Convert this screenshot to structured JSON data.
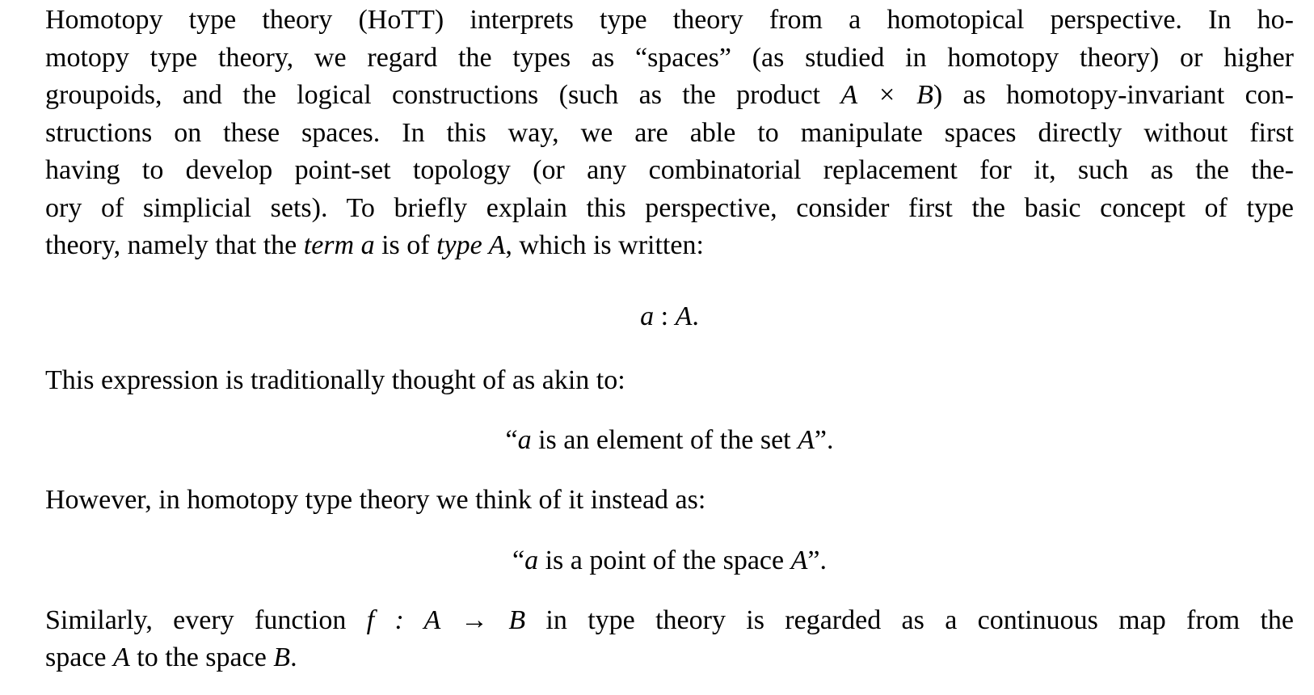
{
  "paragraph_intro": {
    "lines": [
      "Homotopy type theory (HoTT) interprets type theory from a homotopical perspective.  In ho-",
      "motopy type theory, we regard the types as “spaces” (as studied in homotopy theory) or higher",
      "groupoids, and the logical constructions (such as the product ",
      "structions on these spaces.  In this way, we are able to manipulate spaces directly without first",
      "having to develop point-set topology (or any combinatorial replacement for it, such as the the-",
      "ory of simplicial sets). To briefly explain this perspective, consider first the basic concept of type",
      "theory, namely that the "
    ],
    "product_expr": "A × B",
    "line3_tail": ") as homotopy-invariant con-",
    "term_word": "term a",
    "is_of": " is of ",
    "type_word": "type",
    "type_var": " A",
    "written_tail": ", which is written:"
  },
  "display_typing": {
    "a": "a",
    "colon": " : ",
    "A": "A",
    "period": "."
  },
  "paragraph_traditional": {
    "text": "This expression is traditionally thought of as akin to:"
  },
  "display_set": {
    "open_quote": "“",
    "a": "a",
    "middle": " is an element of the set ",
    "A": "A",
    "close": "”."
  },
  "paragraph_however": {
    "text": "However, in homotopy type theory we think of it instead as:"
  },
  "display_space": {
    "open_quote": "“",
    "a": "a",
    "middle": " is a point of the space ",
    "A": "A",
    "close": "”."
  },
  "paragraph_function": {
    "line1_start": "Similarly, every function ",
    "fn_expr": "f : A → B",
    "line1_end": " in type theory is regarded as a continuous map from the",
    "line2_start": "space ",
    "A": "A",
    "line2_mid": " to the space ",
    "B": "B",
    "line2_end": "."
  }
}
